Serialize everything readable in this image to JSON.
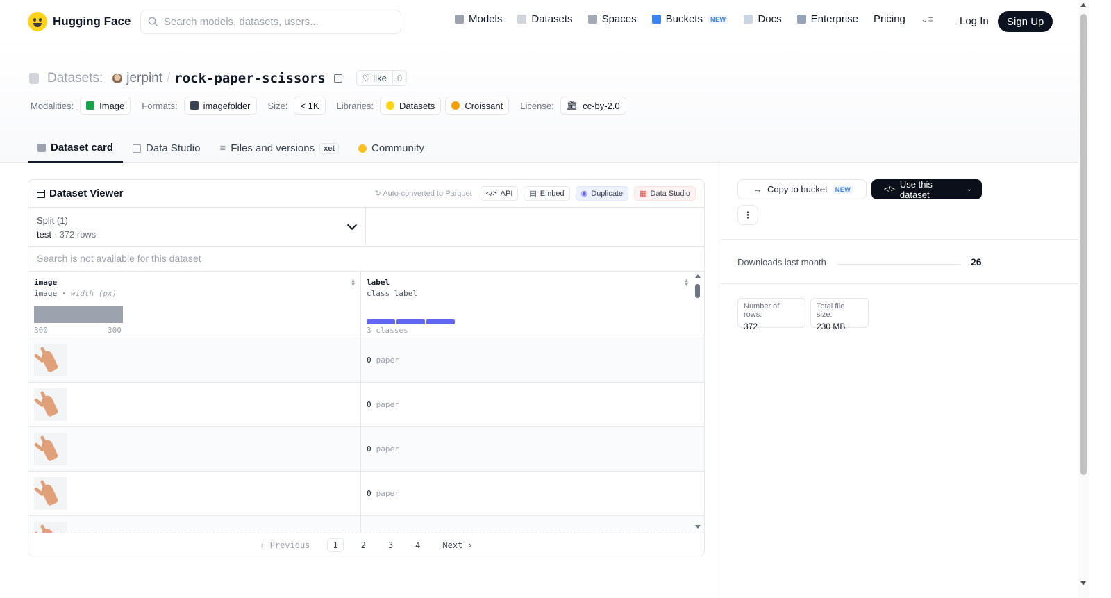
{
  "nav": {
    "brand": "Hugging Face",
    "search_placeholder": "Search models, datasets, users...",
    "links": [
      {
        "label": "Models",
        "icon": "cube-icon",
        "color": "#9ca3af"
      },
      {
        "label": "Datasets",
        "icon": "database-icon",
        "color": "#d1d5db"
      },
      {
        "label": "Spaces",
        "icon": "grid-icon",
        "color": "#a3aab5"
      },
      {
        "label": "Buckets",
        "icon": "bucket-icon",
        "color": "#3b82f6",
        "badge": "NEW"
      },
      {
        "label": "Docs",
        "icon": "book-icon",
        "color": "#cbd5e1"
      },
      {
        "label": "Enterprise",
        "icon": "enterprise-icon",
        "color": "#94a3b8"
      },
      {
        "label": "Pricing"
      }
    ],
    "login": "Log In",
    "signup": "Sign Up"
  },
  "header": {
    "prefix": "Datasets:",
    "owner": "jerpint",
    "separator": "/",
    "repo": "rock-paper-scissors",
    "like_label": "like",
    "like_count": "0",
    "meta": {
      "modalities_label": "Modalities:",
      "modality": "Image",
      "formats_label": "Formats:",
      "format": "imagefolder",
      "size_label": "Size:",
      "size": "< 1K",
      "libraries_label": "Libraries:",
      "library1": "Datasets",
      "library2": "Croissant",
      "license_label": "License:",
      "license": "cc-by-2.0"
    }
  },
  "tabs": [
    {
      "label": "Dataset card",
      "active": true
    },
    {
      "label": "Data Studio"
    },
    {
      "label": "Files and versions",
      "badge": "xet"
    },
    {
      "label": "Community"
    }
  ],
  "viewer": {
    "title": "Dataset Viewer",
    "auto_link": "Auto-converted",
    "auto_rest": " to Parquet",
    "api": "API",
    "embed": "Embed",
    "duplicate": "Duplicate",
    "studio": "Data Studio",
    "split_title": "Split (1)",
    "split_name": "test",
    "split_dot": "·",
    "split_rows": "372 rows",
    "search_note": "Search is not available for this dataset",
    "columns": [
      {
        "name": "image",
        "type": "image",
        "type_extra": "width (px)",
        "min": "300",
        "max": "300"
      },
      {
        "name": "label",
        "type": "class label",
        "classes_note": "3 classes"
      }
    ],
    "rows": [
      {
        "label_id": "0",
        "label_name": "paper"
      },
      {
        "label_id": "0",
        "label_name": "paper"
      },
      {
        "label_id": "0",
        "label_name": "paper"
      },
      {
        "label_id": "0",
        "label_name": "paper"
      },
      {
        "label_id": "",
        "label_name": ""
      }
    ],
    "pager": {
      "prev": "Previous",
      "pages": [
        "1",
        "2",
        "3",
        "4"
      ],
      "next": "Next"
    }
  },
  "sidebar": {
    "copy_bucket": "Copy to bucket",
    "copy_badge": "NEW",
    "use_dataset": "Use this dataset",
    "more": "⋮",
    "downloads_label": "Downloads last month",
    "downloads": "26",
    "rows_label": "Number of rows:",
    "rows": "372",
    "size_label": "Total file size:",
    "size": "230 MB"
  }
}
